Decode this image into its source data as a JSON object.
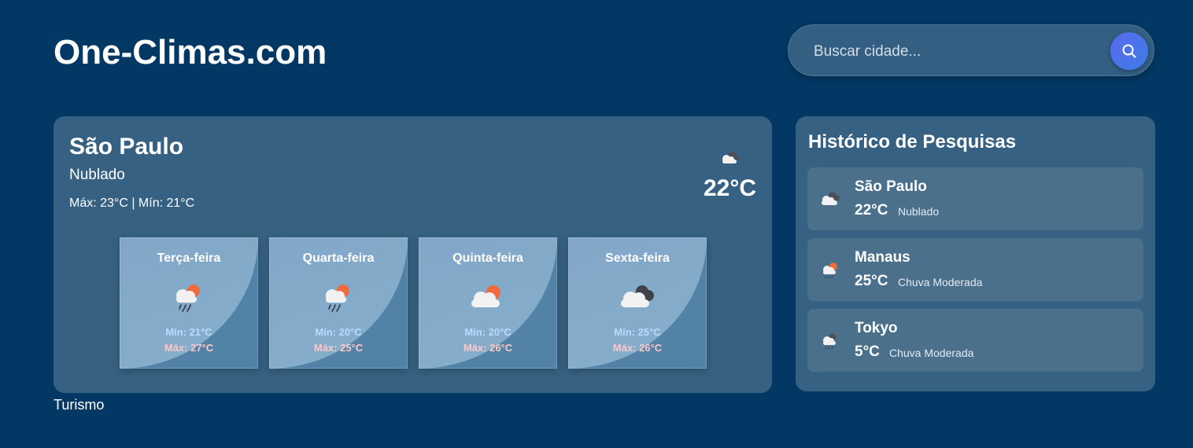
{
  "site": {
    "title": "One-Climas.com"
  },
  "search": {
    "placeholder": "Buscar cidade...",
    "button_icon": "search-icon",
    "button_color": "#4f73ea"
  },
  "current": {
    "city": "São Paulo",
    "description": "Nublado",
    "minmax": "Máx: 23°C | Mín: 21°C",
    "temp": "22°C",
    "icon": "cloudy-icon"
  },
  "forecast": [
    {
      "day": "Terça-feira",
      "min": "Mín: 21°C",
      "max": "Máx: 27°C",
      "icon": "rain-sun-icon"
    },
    {
      "day": "Quarta-feira",
      "min": "Mín: 20°C",
      "max": "Máx: 25°C",
      "icon": "rain-sun-icon"
    },
    {
      "day": "Quinta-feira",
      "min": "Mín: 20°C",
      "max": "Máx: 26°C",
      "icon": "partly-cloudy-icon"
    },
    {
      "day": "Sexta-feira",
      "min": "Mín: 25°C",
      "max": "Máx: 26°C",
      "icon": "cloudy-icon"
    }
  ],
  "history": {
    "title": "Histórico de Pesquisas",
    "items": [
      {
        "city": "São Paulo",
        "temp": "22°C",
        "description": "Nublado",
        "icon": "cloudy-icon"
      },
      {
        "city": "Manaus",
        "temp": "25°C",
        "description": "Chuva Moderada",
        "icon": "rain-sun-icon"
      },
      {
        "city": "Tokyo",
        "temp": "5°C",
        "description": "Chuva Moderada",
        "icon": "rain-cloud-icon"
      }
    ]
  },
  "footer": {
    "link": "Turismo"
  },
  "colors": {
    "background": "#033864",
    "card": "#366182",
    "history_item": "#4a708c",
    "min_text": "#b8dcff",
    "max_text": "#ffc8c8"
  }
}
